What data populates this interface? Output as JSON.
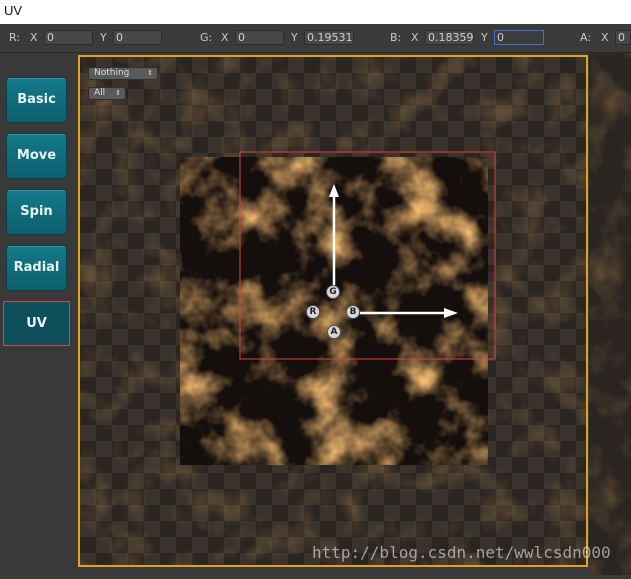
{
  "window": {
    "title": "UV"
  },
  "toolbar": {
    "r": {
      "label": "R:",
      "x_label": "X",
      "x_value": "0",
      "y_label": "Y",
      "y_value": "0"
    },
    "g": {
      "label": "G:",
      "x_label": "X",
      "x_value": "0",
      "y_label": "Y",
      "y_value": "0.19531"
    },
    "b": {
      "label": "B:",
      "x_label": "X",
      "x_value": "0.18359",
      "y_label": "Y",
      "y_value": "0"
    },
    "a": {
      "label": "A:",
      "x_label": "X",
      "x_value": "0"
    }
  },
  "sidebar": {
    "items": [
      {
        "label": "Basic"
      },
      {
        "label": "Move"
      },
      {
        "label": "Spin"
      },
      {
        "label": "Radial"
      },
      {
        "label": "UV",
        "selected": true
      }
    ]
  },
  "viewport": {
    "dropdowns": [
      {
        "value": "Nothing"
      },
      {
        "value": "All"
      }
    ],
    "handles": [
      {
        "label": "G"
      },
      {
        "label": "R"
      },
      {
        "label": "B"
      },
      {
        "label": "A"
      }
    ]
  },
  "watermark": "http://blog.csdn.net/wwlcsdn000",
  "colors": {
    "frame": "#e2a21b",
    "selection": "#e04040",
    "button": "#13798a",
    "active_field_border": "#4a6bd6"
  }
}
